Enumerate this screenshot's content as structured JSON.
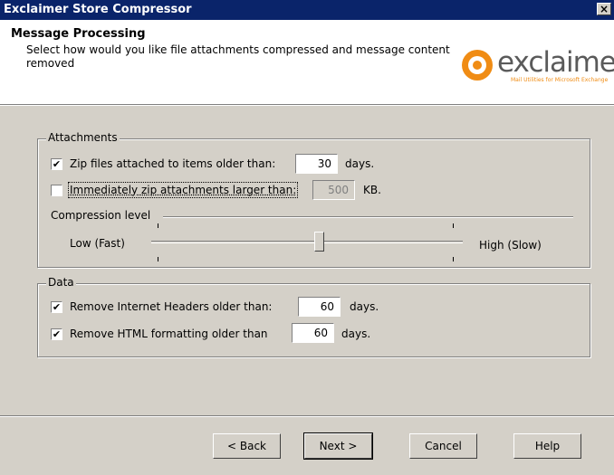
{
  "window": {
    "title": "Exclaimer Store Compressor",
    "close_glyph": "×"
  },
  "header": {
    "title": "Message Processing",
    "description": "Select how would you like file attachments compressed and message content removed",
    "logo": {
      "text": "exclaimer",
      "tm": "™",
      "tagline": "Mail Utilities for Microsoft Exchange",
      "brand_color": "#f08c14"
    }
  },
  "attachments": {
    "group_label": "Attachments",
    "zip_older": {
      "checked": true,
      "label": "Zip files attached to items older than:",
      "value": "30",
      "unit": "days."
    },
    "zip_larger": {
      "checked": false,
      "label": "Immediately zip attachments larger than:",
      "value": "500",
      "unit": "KB."
    },
    "compression": {
      "label": "Compression level",
      "low_label": "Low (Fast)",
      "high_label": "High (Slow)",
      "level_fraction": 0.54
    }
  },
  "data": {
    "group_label": "Data",
    "remove_headers": {
      "checked": true,
      "label": "Remove Internet Headers older than:",
      "value": "60",
      "unit": "days."
    },
    "remove_html": {
      "checked": true,
      "label": "Remove HTML formatting older than",
      "value": "60",
      "unit": "days."
    }
  },
  "footer": {
    "back": "< Back",
    "next": "Next >",
    "cancel": "Cancel",
    "help": "Help"
  },
  "check_glyph": "✔"
}
